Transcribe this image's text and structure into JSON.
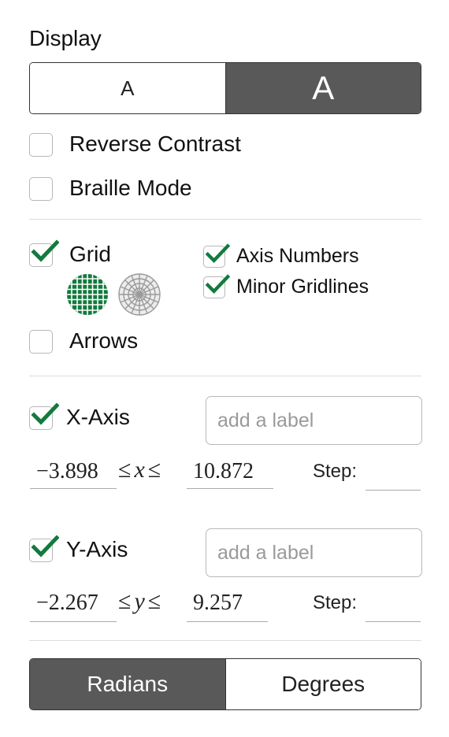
{
  "display": {
    "title": "Display",
    "size_toggle": {
      "small_label": "A",
      "large_label": "A",
      "selected": "large"
    },
    "reverse_contrast": {
      "label": "Reverse Contrast",
      "checked": false
    },
    "braille_mode": {
      "label": "Braille Mode",
      "checked": false
    }
  },
  "grid_section": {
    "grid": {
      "label": "Grid",
      "checked": true,
      "styles": [
        "cartesian-grid-icon",
        "polar-grid-icon"
      ],
      "selected_style": "cartesian"
    },
    "axis_numbers": {
      "label": "Axis Numbers",
      "checked": true
    },
    "minor_gridlines": {
      "label": "Minor Gridlines",
      "checked": true
    },
    "arrows": {
      "label": "Arrows",
      "checked": false
    }
  },
  "x_axis": {
    "label": "X-Axis",
    "checked": true,
    "axis_label_placeholder": "add a label",
    "min": "−3.898",
    "max": "10.872",
    "variable": "x",
    "relation": "≤",
    "step_label": "Step:",
    "step_value": ""
  },
  "y_axis": {
    "label": "Y-Axis",
    "checked": true,
    "axis_label_placeholder": "add a label",
    "min": "−2.267",
    "max": "9.257",
    "variable": "y",
    "relation": "≤",
    "step_label": "Step:",
    "step_value": ""
  },
  "angle_mode": {
    "radians_label": "Radians",
    "degrees_label": "Degrees",
    "selected": "radians"
  },
  "colors": {
    "accent_green": "#127a3d",
    "active_segment": "#595959",
    "divider": "#dcdcdc"
  }
}
